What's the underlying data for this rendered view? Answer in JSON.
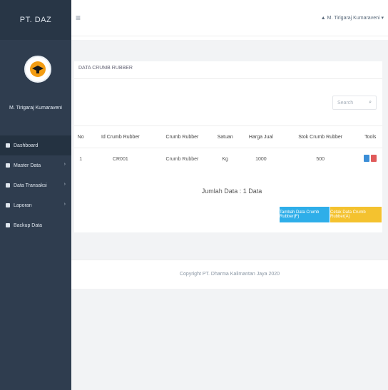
{
  "brand": {
    "title": "PT. DAZ"
  },
  "user": {
    "name": "M. Tirigaraj Kumaraveni"
  },
  "sidebar": {
    "items": [
      {
        "label": "Dashboard",
        "icon": "dashboard-icon",
        "has_children": false,
        "active": true
      },
      {
        "label": "Master Data",
        "icon": "database-icon",
        "has_children": true,
        "active": false
      },
      {
        "label": "Data Transaksi",
        "icon": "transaction-icon",
        "has_children": true,
        "active": false
      },
      {
        "label": "Laporan",
        "icon": "report-icon",
        "has_children": true,
        "active": false
      },
      {
        "label": "Backup Data",
        "icon": "backup-icon",
        "has_children": false,
        "active": false
      }
    ],
    "chevron_glyph": "›"
  },
  "topbar": {
    "menu_icon_glyph": "≡",
    "user_label": "M. Tirigaraj Kumaraveni ▾",
    "user_icon_glyph": "▲"
  },
  "panel": {
    "title": "DATA CRUMB RUBBER"
  },
  "search": {
    "placeholder": "Search",
    "icon_glyph": "⌕"
  },
  "table": {
    "headers": [
      "No",
      "Id Crumb Rubber",
      "Crumb Rubber",
      "Satuan",
      "Harga Jual",
      "Stok Crumb Rubber",
      "Tools"
    ],
    "rows": [
      {
        "no": "1",
        "id": "CR001",
        "name": "Crumb Rubber",
        "unit": "Kg",
        "price": "1000",
        "stock": "500"
      }
    ]
  },
  "summary": {
    "total_label": "Jumlah Data : 1 Data"
  },
  "actions": {
    "blue_label": "Tambah Data Crumb Rubber(F)",
    "yellow_label": "Cetak Data Crumb Rubber(A)"
  },
  "footer": {
    "text": "Copyright PT. Dharma Kalimantan Jaya 2020"
  },
  "colors": {
    "sidebar_bg": "#2f3d4f",
    "accent_blue": "#2eaee9",
    "accent_yellow": "#f4c22f",
    "danger": "#e05a5a",
    "primary": "#3b8ed7"
  }
}
